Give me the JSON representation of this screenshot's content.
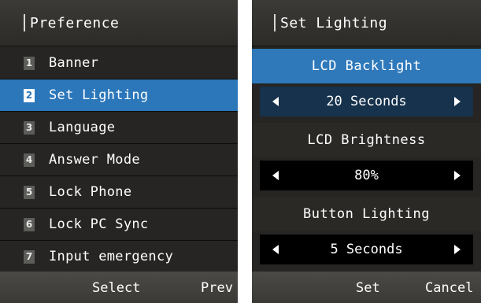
{
  "left": {
    "title": "Preference",
    "items": [
      {
        "num": "1",
        "label": "Banner"
      },
      {
        "num": "2",
        "label": "Set Lighting"
      },
      {
        "num": "3",
        "label": "Language"
      },
      {
        "num": "4",
        "label": "Answer Mode"
      },
      {
        "num": "5",
        "label": "Lock Phone"
      },
      {
        "num": "6",
        "label": "Lock PC Sync"
      },
      {
        "num": "7",
        "label": "Input emergency"
      }
    ],
    "selected_index": 1,
    "softkeys": {
      "center": "Select",
      "right": "Prev"
    }
  },
  "right": {
    "title": "Set Lighting",
    "settings": [
      {
        "label": "LCD Backlight",
        "value": "20 Seconds"
      },
      {
        "label": "LCD Brightness",
        "value": "80%"
      },
      {
        "label": "Button Lighting",
        "value": "5 Seconds"
      }
    ],
    "softkeys": {
      "center": "Set",
      "right": "Cancel"
    }
  },
  "colors": {
    "highlight": "#2b77ba",
    "background": "#262523"
  }
}
